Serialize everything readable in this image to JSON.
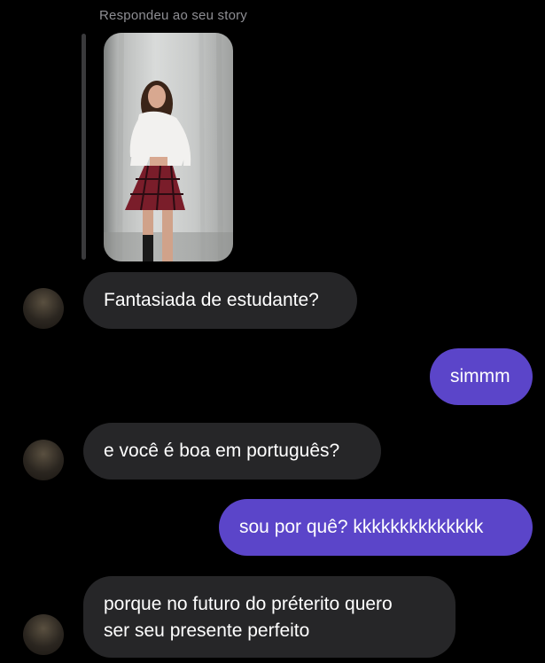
{
  "story": {
    "caption": "Respondeu ao seu story"
  },
  "messages": [
    {
      "side": "incoming",
      "text": "Fantasiada de estudante?"
    },
    {
      "side": "outgoing",
      "text": "simmm"
    },
    {
      "side": "incoming",
      "text": "e você é boa em português?"
    },
    {
      "side": "outgoing",
      "text": "sou por quê? kkkkkkkkkkkkkk"
    },
    {
      "side": "incoming",
      "lines": [
        "porque no futuro do préterito quero",
        "ser seu presente perfeito"
      ]
    }
  ],
  "colors": {
    "background": "#000000",
    "incoming_bubble": "#262628",
    "outgoing_bubble": "#5b45c9",
    "caption": "#8e8e93"
  }
}
